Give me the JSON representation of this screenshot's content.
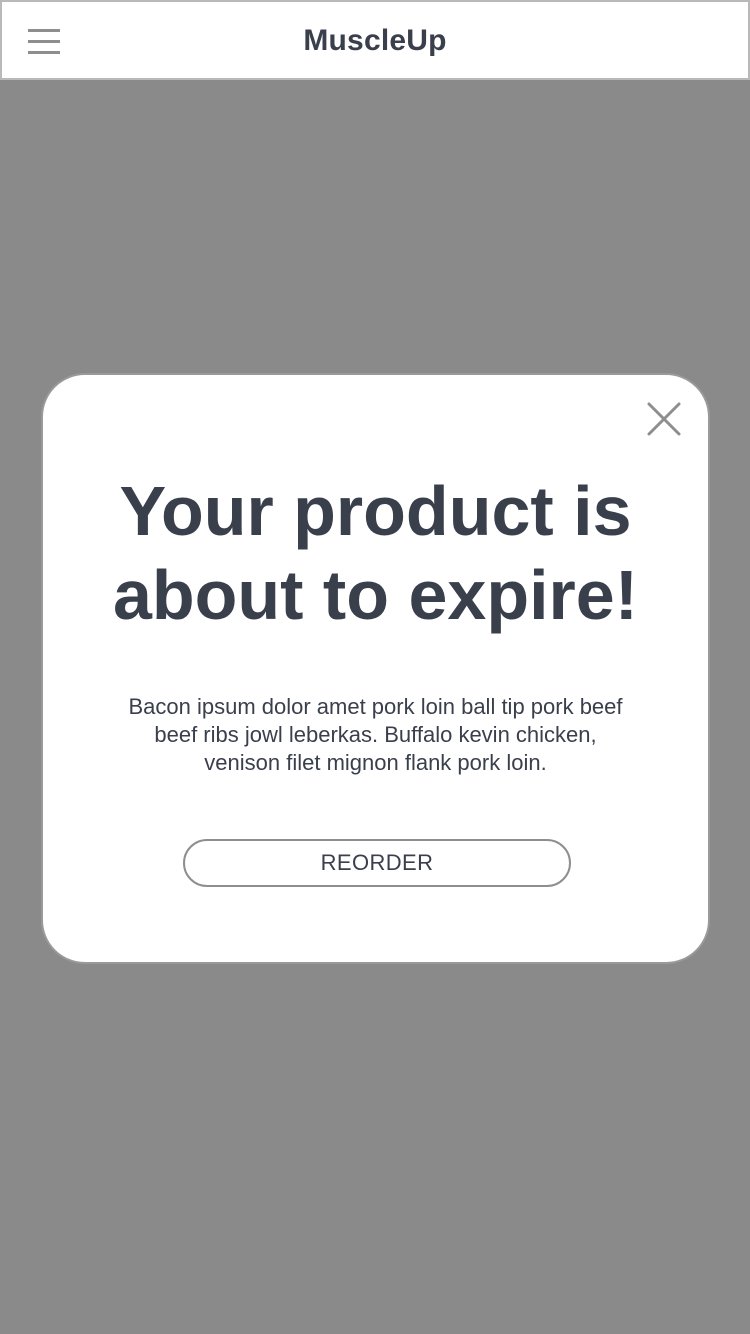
{
  "app_bar": {
    "title": "MuscleUp",
    "menu_icon": "hamburger-menu-icon"
  },
  "modal": {
    "close_icon": "close-icon",
    "title": "Your product is about to expire!",
    "body": "Bacon ipsum dolor amet pork loin ball tip pork beef beef ribs jowl leberkas. Buffalo kevin chicken, venison filet mignon flank pork loin.",
    "reorder_label": "REORDER"
  },
  "colors": {
    "text": "#3a3f4c",
    "backdrop": "#8a8a8a",
    "surface": "#ffffff",
    "icon": "#8e8e8e"
  }
}
